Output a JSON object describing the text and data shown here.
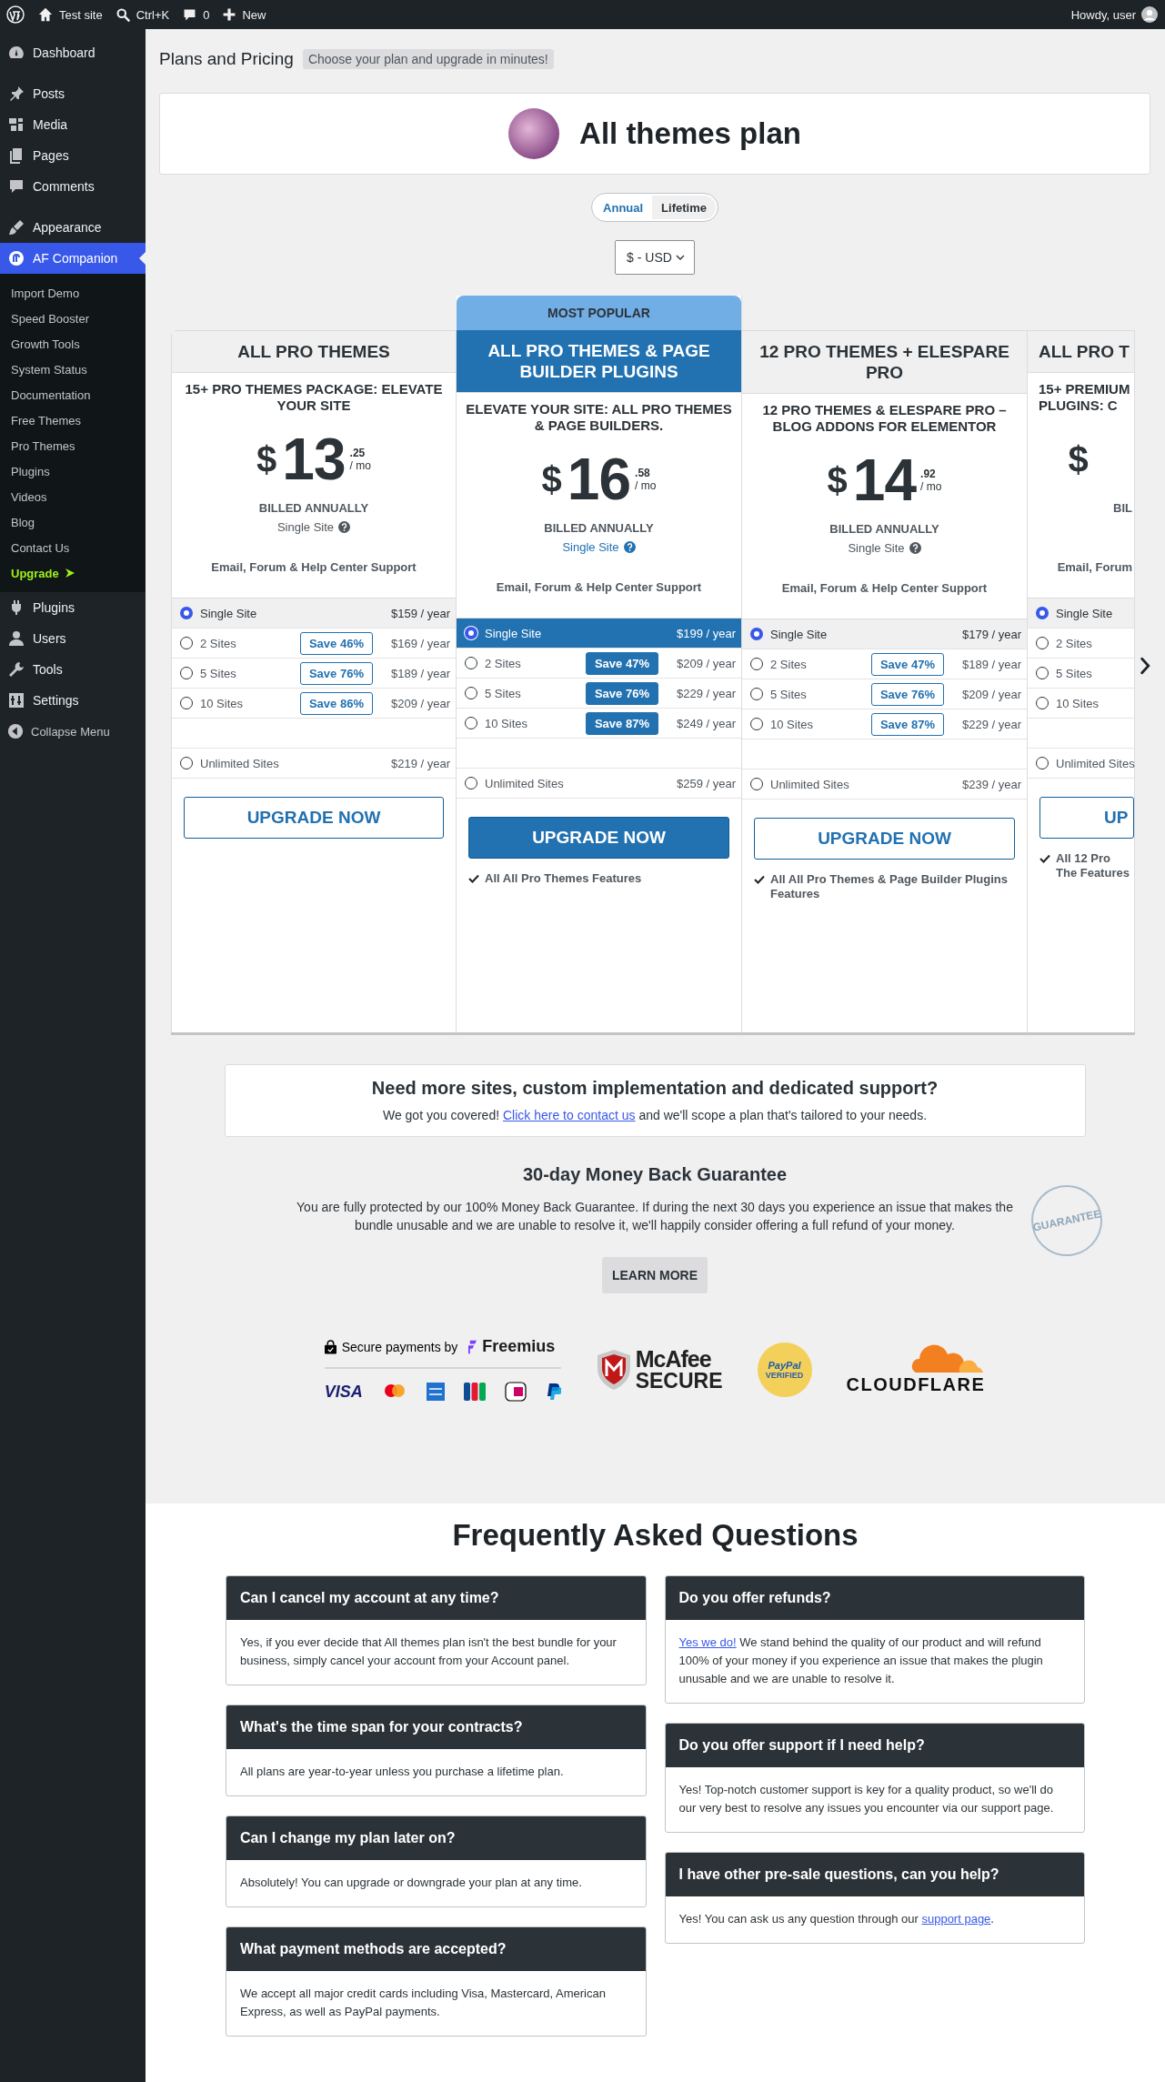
{
  "admin_bar": {
    "site": "Test site",
    "search": "Ctrl+K",
    "comments": "0",
    "new": "New",
    "greeting": "Howdy, user"
  },
  "sidebar": {
    "groups": [
      [
        {
          "label": "Dashboard",
          "selected": false
        }
      ],
      [
        {
          "label": "Posts",
          "selected": false
        },
        {
          "label": "Media",
          "selected": false
        },
        {
          "label": "Pages",
          "selected": false
        },
        {
          "label": "Comments",
          "selected": false
        }
      ],
      [
        {
          "label": "Appearance",
          "selected": false
        },
        {
          "label": "AF Companion",
          "selected": true,
          "children": [
            {
              "label": "Import Demo",
              "kind": "link"
            },
            {
              "label": "Speed Booster",
              "kind": "link"
            },
            {
              "label": "Growth Tools",
              "kind": "link"
            },
            {
              "label": "System Status",
              "kind": "link"
            },
            {
              "label": "Documentation",
              "kind": "link"
            },
            {
              "label": "Free Themes",
              "kind": "link"
            },
            {
              "label": "Pro Themes",
              "kind": "link"
            },
            {
              "label": "Plugins",
              "kind": "link"
            },
            {
              "label": "Videos",
              "kind": "link"
            },
            {
              "label": "Blog",
              "kind": "link"
            },
            {
              "label": "Contact Us",
              "kind": "link"
            },
            {
              "label": "Upgrade",
              "kind": "upgrade"
            }
          ]
        },
        {
          "label": "Plugins",
          "selected": false
        },
        {
          "label": "Users",
          "selected": false
        },
        {
          "label": "Tools",
          "selected": false
        },
        {
          "label": "Settings",
          "selected": false
        }
      ]
    ],
    "collapse": "Collapse Menu"
  },
  "header": {
    "title": "Plans and Pricing",
    "tagline": "Choose your plan and upgrade in minutes!"
  },
  "product": {
    "name": "All themes plan"
  },
  "billing_toggle": [
    {
      "label": "Annual",
      "selected": true
    },
    {
      "label": "Lifetime",
      "selected": false
    }
  ],
  "currency": {
    "value": "$ - USD"
  },
  "plans": [
    {
      "featured": false,
      "title": "ALL PRO THEMES",
      "subtitle": "15+ PRO THEMES PACKAGE: ELEVATE YOUR SITE",
      "currency": "$",
      "price": "13",
      "cents": ".25",
      "period": "/ mo",
      "billing": "BILLED ANNUALLY",
      "sites_label": "Single Site",
      "support": "Email, Forum & Help Center Support",
      "options": [
        {
          "label": "Single Site",
          "price": "$159 / year",
          "selected": true
        },
        {
          "label": "2 Sites",
          "save": "Save 46%",
          "price": "$169 / year",
          "selected": false
        },
        {
          "label": "5 Sites",
          "save": "Save 76%",
          "price": "$189 / year",
          "selected": false
        },
        {
          "label": "10 Sites",
          "save": "Save 86%",
          "price": "$209 / year",
          "selected": false
        },
        {
          "label": "Unlimited Sites",
          "price": "$219 / year",
          "selected": false
        }
      ],
      "button": "UPGRADE NOW"
    },
    {
      "featured": true,
      "badge": "MOST POPULAR",
      "title": "ALL PRO THEMES & PAGE BUILDER PLUGINS",
      "subtitle": "ELEVATE YOUR SITE: ALL PRO THEMES & PAGE BUILDERS.",
      "currency": "$",
      "price": "16",
      "cents": ".58",
      "period": "/ mo",
      "billing": "BILLED ANNUALLY",
      "sites_label": "Single Site",
      "support": "Email, Forum & Help Center Support",
      "options": [
        {
          "label": "Single Site",
          "price": "$199 / year",
          "selected": true
        },
        {
          "label": "2 Sites",
          "save": "Save 47%",
          "price": "$209 / year",
          "selected": false
        },
        {
          "label": "5 Sites",
          "save": "Save 76%",
          "price": "$229 / year",
          "selected": false
        },
        {
          "label": "10 Sites",
          "save": "Save 87%",
          "price": "$249 / year",
          "selected": false
        },
        {
          "label": "Unlimited Sites",
          "price": "$259 / year",
          "selected": false
        }
      ],
      "button": "UPGRADE NOW",
      "features": [
        "All All Pro Themes Features"
      ]
    },
    {
      "featured": false,
      "title": "12 PRO THEMES + ELESPARE PRO",
      "subtitle": "12 PRO THEMES & ELESPARE PRO – BLOG ADDONS FOR ELEMENTOR",
      "currency": "$",
      "price": "14",
      "cents": ".92",
      "period": "/ mo",
      "billing": "BILLED ANNUALLY",
      "sites_label": "Single Site",
      "support": "Email, Forum & Help Center Support",
      "options": [
        {
          "label": "Single Site",
          "price": "$179 / year",
          "selected": true
        },
        {
          "label": "2 Sites",
          "save": "Save 47%",
          "price": "$189 / year",
          "selected": false
        },
        {
          "label": "5 Sites",
          "save": "Save 76%",
          "price": "$209 / year",
          "selected": false
        },
        {
          "label": "10 Sites",
          "save": "Save 87%",
          "price": "$229 / year",
          "selected": false
        },
        {
          "label": "Unlimited Sites",
          "price": "$239 / year",
          "selected": false
        }
      ],
      "button": "UPGRADE NOW",
      "features": [
        "All All Pro Themes & Page Builder Plugins Features"
      ]
    },
    {
      "featured": false,
      "title": "ALL PRO T",
      "subtitle": "15+ PREMIUM PLUGINS: C",
      "currency": "$",
      "billing": "BIL",
      "support": "Email, Forum",
      "options": [
        {
          "label": "Single Site",
          "selected": true
        },
        {
          "label": "2 Sites",
          "selected": false
        },
        {
          "label": "5 Sites",
          "selected": false
        },
        {
          "label": "10 Sites",
          "selected": false
        },
        {
          "label": "Unlimited Sites",
          "selected": false
        }
      ],
      "button": "UP",
      "features": [
        "All 12 Pro The Features"
      ]
    }
  ],
  "custom_offer": {
    "title": "Need more sites, custom implementation and dedicated support?",
    "text_before": "We got you covered!",
    "link": "Click here to contact us",
    "text_after": "and we'll scope a plan that's tailored to your needs."
  },
  "guarantee": {
    "title": "30-day Money Back Guarantee",
    "text": "You are fully protected by our 100% Money Back Guarantee. If during the next 30 days you experience an issue that makes the bundle unusable and we are unable to resolve it, we'll happily consider offering a full refund of your money.",
    "button": "LEARN MORE",
    "stamp": "GUARANTEE"
  },
  "trust": {
    "secure_text": "Secure payments by",
    "freemius": "Freemius",
    "visa": "VISA",
    "mcafee": "McAfee",
    "mcafee_secure": "SECURE",
    "paypal": "PayPal",
    "paypal_verified": "VERIFIED",
    "cloudflare": "CLOUDFLARE"
  },
  "faq": {
    "title": "Frequently Asked Questions",
    "columns": [
      [
        {
          "question": "Can I cancel my account at any time?",
          "answer": [
            {
              "kind": "text",
              "text": "Yes, if you ever decide that All themes plan isn't the best bundle for your business, simply cancel your account from your Account panel."
            }
          ]
        },
        {
          "question": "What's the time span for your contracts?",
          "answer": [
            {
              "kind": "text",
              "text": "All plans are year-to-year unless you purchase a lifetime plan."
            }
          ]
        },
        {
          "question": "Can I change my plan later on?",
          "answer": [
            {
              "kind": "text",
              "text": "Absolutely! You can upgrade or downgrade your plan at any time."
            }
          ]
        },
        {
          "question": "What payment methods are accepted?",
          "answer": [
            {
              "kind": "text",
              "text": "We accept all major credit cards including Visa, Mastercard, American Express, as well as PayPal payments."
            }
          ]
        }
      ],
      [
        {
          "question": "Do you offer refunds?",
          "answer": [
            {
              "kind": "link",
              "text": "Yes we do!"
            },
            {
              "kind": "text",
              "text": " We stand behind the quality of our product and will refund 100% of your money if you experience an issue that makes the plugin unusable and we are unable to resolve it."
            }
          ]
        },
        {
          "question": "Do you offer support if I need help?",
          "answer": [
            {
              "kind": "text",
              "text": "Yes! Top-notch customer support is key for a quality product, so we'll do our very best to resolve any issues you encounter via our support page."
            }
          ]
        },
        {
          "question": "I have other pre-sale questions, can you help?",
          "answer": [
            {
              "kind": "text",
              "text": "Yes! You can ask us any question through our "
            },
            {
              "kind": "link",
              "text": "support page"
            },
            {
              "kind": "text",
              "text": "."
            }
          ]
        }
      ]
    ]
  }
}
